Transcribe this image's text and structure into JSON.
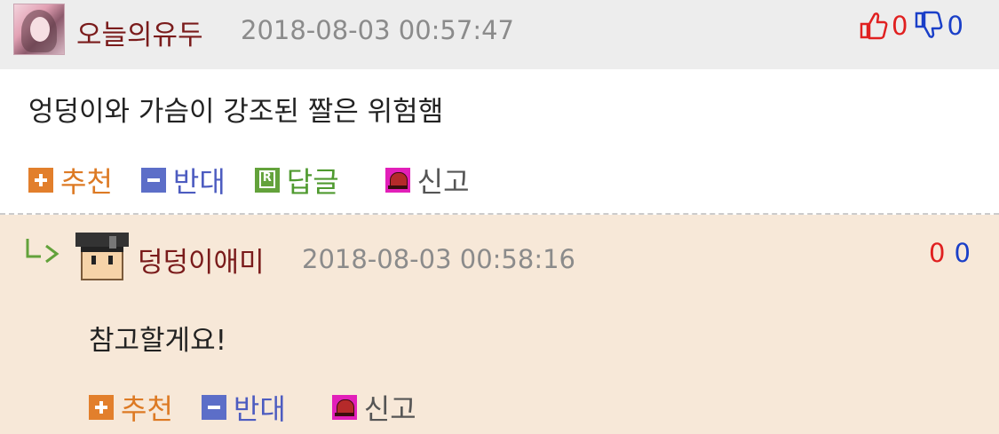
{
  "comment1": {
    "author": "오늘의유두",
    "datetime": "2018-08-03 00:57:47",
    "upvotes": "0",
    "downvotes": "0",
    "body": "엉덩이와 가슴이 강조된 짤은 위험햄",
    "actions": {
      "recommend": "추천",
      "oppose": "반대",
      "reply": "답글",
      "report": "신고"
    }
  },
  "comment2": {
    "author": "덩덩이애미",
    "datetime": "2018-08-03 00:58:16",
    "upvotes": "0",
    "downvotes": "0",
    "body": "참고할게요!",
    "actions": {
      "recommend": "추천",
      "oppose": "반대",
      "report": "신고"
    }
  },
  "colors": {
    "header_bg": "#ededed",
    "reply_bg": "#f7e8d8",
    "nickname": "#7a1b1b",
    "upvote": "#e02020",
    "downvote": "#1a3fc8",
    "recommend": "#dd7a24",
    "oppose": "#4d5cc0",
    "reply": "#4f9a2f"
  },
  "icons": [
    "thumbs-up-icon",
    "thumbs-down-icon",
    "plus-icon",
    "minus-icon",
    "reply-icon",
    "report-bell-icon",
    "reply-arrow-icon"
  ]
}
